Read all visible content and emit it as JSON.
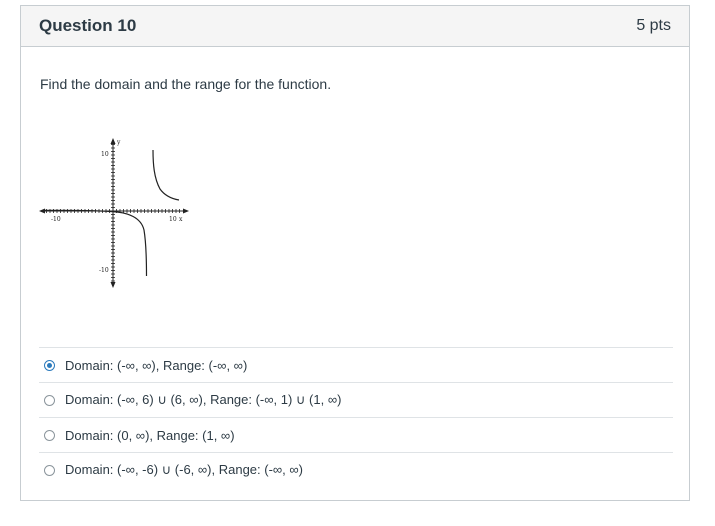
{
  "question": {
    "title": "Question 10",
    "points": "5 pts",
    "prompt": "Find the domain and the range for the function."
  },
  "graph": {
    "x_axis_label": "x",
    "y_axis_label": "y",
    "ticks": {
      "y_top": "10",
      "y_bottom": "-10",
      "x_left": "-10",
      "x_right": "10"
    }
  },
  "answers": [
    {
      "label": "Domain: (-∞, ∞), Range: (-∞, ∞)",
      "selected": true
    },
    {
      "label": "Domain: (-∞, 6) ∪ (6, ∞), Range: (-∞, 1) ∪ (1, ∞)",
      "selected": false
    },
    {
      "label": "Domain: (0, ∞), Range: (1, ∞)",
      "selected": false
    },
    {
      "label": "Domain: (-∞, -6) ∪ (-6, ∞), Range: (-∞, ∞)",
      "selected": false
    }
  ],
  "colors": {
    "accent": "#2b7abc",
    "header_bg": "#f5f5f5",
    "border": "#c7cdd1"
  }
}
